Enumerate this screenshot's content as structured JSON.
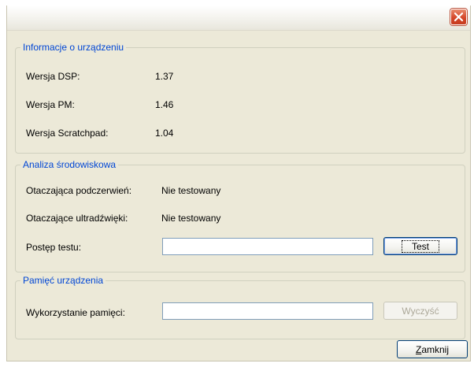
{
  "device_info": {
    "legend": "Informacje o urządzeniu",
    "rows": [
      {
        "label": "Wersja DSP:",
        "value": "1.37"
      },
      {
        "label": "Wersja PM:",
        "value": "1.46"
      },
      {
        "label": "Wersja Scratchpad:",
        "value": "1.04"
      }
    ]
  },
  "environment": {
    "legend": "Analiza środowiskowa",
    "infrared_label": "Otaczająca podczerwień:",
    "infrared_value": "Nie testowany",
    "ultrasound_label": "Otaczające ultradźwięki:",
    "ultrasound_value": "Nie testowany",
    "progress_label": "Postęp testu:",
    "progress_fraction": 0,
    "test_button": "Test"
  },
  "memory": {
    "legend": "Pamięć urządzenia",
    "usage_label": "Wykorzystanie pamięci:",
    "usage_fraction": 0,
    "clear_button": "Wyczyść",
    "clear_enabled": false
  },
  "footer": {
    "close_button_mnemonic": "Z",
    "close_button_rest": "amknij"
  },
  "titlebar": {
    "close_icon": "close-x-icon"
  }
}
